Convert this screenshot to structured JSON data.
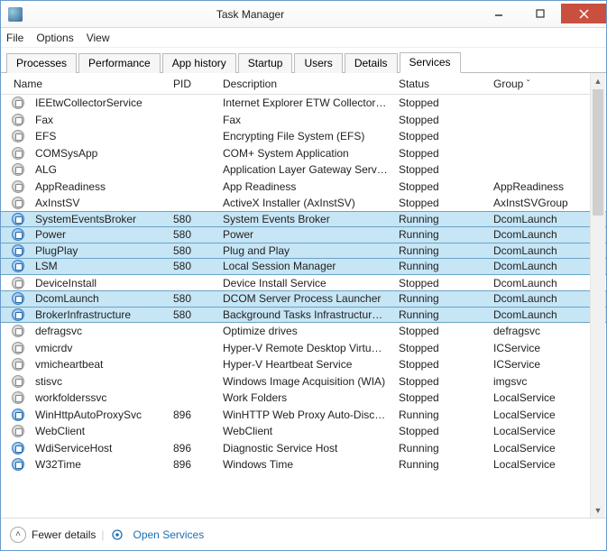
{
  "window": {
    "title": "Task Manager"
  },
  "menubar": [
    "File",
    "Options",
    "View"
  ],
  "tabs": [
    {
      "label": "Processes"
    },
    {
      "label": "Performance"
    },
    {
      "label": "App history"
    },
    {
      "label": "Startup"
    },
    {
      "label": "Users"
    },
    {
      "label": "Details"
    },
    {
      "label": "Services",
      "active": true
    }
  ],
  "columns": {
    "name": "Name",
    "pid": "PID",
    "desc": "Description",
    "status": "Status",
    "group": "Group"
  },
  "services": [
    {
      "name": "IEEtwCollectorService",
      "pid": "",
      "desc": "Internet Explorer ETW Collector S...",
      "status": "Stopped",
      "group": ""
    },
    {
      "name": "Fax",
      "pid": "",
      "desc": "Fax",
      "status": "Stopped",
      "group": ""
    },
    {
      "name": "EFS",
      "pid": "",
      "desc": "Encrypting File System (EFS)",
      "status": "Stopped",
      "group": ""
    },
    {
      "name": "COMSysApp",
      "pid": "",
      "desc": "COM+ System Application",
      "status": "Stopped",
      "group": ""
    },
    {
      "name": "ALG",
      "pid": "",
      "desc": "Application Layer Gateway Service",
      "status": "Stopped",
      "group": ""
    },
    {
      "name": "AppReadiness",
      "pid": "",
      "desc": "App Readiness",
      "status": "Stopped",
      "group": "AppReadiness"
    },
    {
      "name": "AxInstSV",
      "pid": "",
      "desc": "ActiveX Installer (AxInstSV)",
      "status": "Stopped",
      "group": "AxInstSVGroup"
    },
    {
      "name": "SystemEventsBroker",
      "pid": "580",
      "desc": "System Events Broker",
      "status": "Running",
      "group": "DcomLaunch",
      "selected": true
    },
    {
      "name": "Power",
      "pid": "580",
      "desc": "Power",
      "status": "Running",
      "group": "DcomLaunch",
      "selected": true
    },
    {
      "name": "PlugPlay",
      "pid": "580",
      "desc": "Plug and Play",
      "status": "Running",
      "group": "DcomLaunch",
      "selected": true
    },
    {
      "name": "LSM",
      "pid": "580",
      "desc": "Local Session Manager",
      "status": "Running",
      "group": "DcomLaunch",
      "selected": true
    },
    {
      "name": "DeviceInstall",
      "pid": "",
      "desc": "Device Install Service",
      "status": "Stopped",
      "group": "DcomLaunch"
    },
    {
      "name": "DcomLaunch",
      "pid": "580",
      "desc": "DCOM Server Process Launcher",
      "status": "Running",
      "group": "DcomLaunch",
      "selected": true
    },
    {
      "name": "BrokerInfrastructure",
      "pid": "580",
      "desc": "Background Tasks Infrastructure ...",
      "status": "Running",
      "group": "DcomLaunch",
      "selected": true
    },
    {
      "name": "defragsvc",
      "pid": "",
      "desc": "Optimize drives",
      "status": "Stopped",
      "group": "defragsvc"
    },
    {
      "name": "vmicrdv",
      "pid": "",
      "desc": "Hyper-V Remote Desktop Virtual...",
      "status": "Stopped",
      "group": "ICService"
    },
    {
      "name": "vmicheartbeat",
      "pid": "",
      "desc": "Hyper-V Heartbeat Service",
      "status": "Stopped",
      "group": "ICService"
    },
    {
      "name": "stisvc",
      "pid": "",
      "desc": "Windows Image Acquisition (WIA)",
      "status": "Stopped",
      "group": "imgsvc"
    },
    {
      "name": "workfolderssvc",
      "pid": "",
      "desc": "Work Folders",
      "status": "Stopped",
      "group": "LocalService"
    },
    {
      "name": "WinHttpAutoProxySvc",
      "pid": "896",
      "desc": "WinHTTP Web Proxy Auto-Disco...",
      "status": "Running",
      "group": "LocalService"
    },
    {
      "name": "WebClient",
      "pid": "",
      "desc": "WebClient",
      "status": "Stopped",
      "group": "LocalService"
    },
    {
      "name": "WdiServiceHost",
      "pid": "896",
      "desc": "Diagnostic Service Host",
      "status": "Running",
      "group": "LocalService"
    },
    {
      "name": "W32Time",
      "pid": "896",
      "desc": "Windows Time",
      "status": "Running",
      "group": "LocalService"
    }
  ],
  "footer": {
    "fewer": "Fewer details",
    "open": "Open Services"
  }
}
